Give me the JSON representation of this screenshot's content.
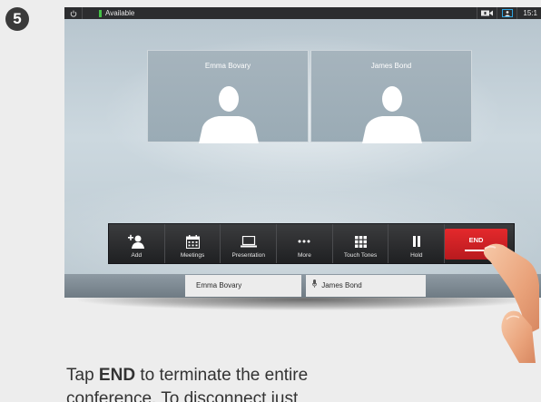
{
  "step": {
    "number": "5"
  },
  "statusbar": {
    "availability": "Available",
    "time": "15:1"
  },
  "participants": [
    {
      "name": "Emma Bovary"
    },
    {
      "name": "James Bond"
    }
  ],
  "toolbar": {
    "add": "Add",
    "meetings": "Meetings",
    "presentation": "Presentation",
    "more": "More",
    "touch_tones": "Touch Tones",
    "hold": "Hold",
    "end": "END"
  },
  "calls": [
    {
      "name": "Emma Bovary"
    },
    {
      "name": "James Bond"
    }
  ],
  "caption": {
    "prefix": "Tap ",
    "emph": "END",
    "rest": " to terminate the entire",
    "line2": "conference. To disconnect just"
  },
  "colors": {
    "end_red": "#d42226",
    "available_green": "#45c247"
  }
}
